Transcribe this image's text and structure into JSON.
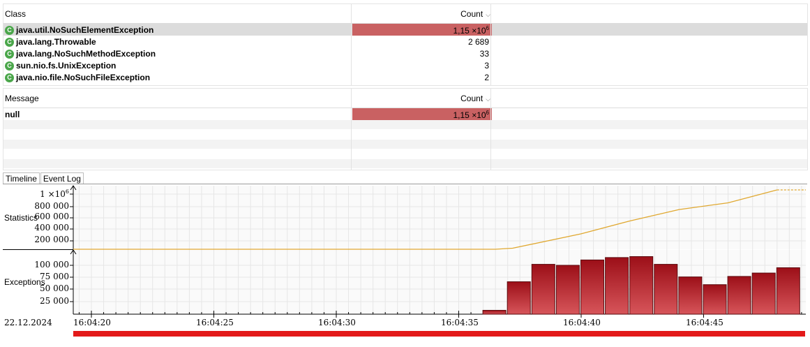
{
  "class_table": {
    "col_class": "Class",
    "col_count": "Count",
    "rows": [
      {
        "name": "java.util.NoSuchElementException",
        "count": "1,15 ×10",
        "exp": "6",
        "fraction": 1.0
      },
      {
        "name": "java.lang.Throwable",
        "count": "2 689",
        "exp": "",
        "fraction": 0
      },
      {
        "name": "java.lang.NoSuchMethodException",
        "count": "33",
        "exp": "",
        "fraction": 0
      },
      {
        "name": "sun.nio.fs.UnixException",
        "count": "3",
        "exp": "",
        "fraction": 0
      },
      {
        "name": "java.nio.file.NoSuchFileException",
        "count": "2",
        "exp": "",
        "fraction": 0
      }
    ]
  },
  "message_table": {
    "col_message": "Message",
    "col_count": "Count",
    "rows": [
      {
        "name": "null",
        "count": "1,15 ×10",
        "exp": "6",
        "fraction": 1.0
      }
    ]
  },
  "tabs": [
    {
      "label": "Timeline",
      "active": true
    },
    {
      "label": "Event Log",
      "active": false
    }
  ],
  "timeline": {
    "date": "22.12.2024",
    "statistics_label": "Statistics",
    "exceptions_label": "Exceptions",
    "stat_ticks": [
      "1 ×10",
      "800 000",
      "600 000",
      "400 000",
      "200 000"
    ],
    "stat_top_exp": "6",
    "exc_ticks": [
      "100 000",
      "75 000",
      "50 000",
      "25 000"
    ],
    "x_ticks": [
      "16:04:20",
      "16:04:25",
      "16:04:30",
      "16:04:35",
      "16:04:40",
      "16:04:45"
    ],
    "line_color": "#e0a830",
    "bar_color": "#b01a22"
  },
  "chart_data": [
    {
      "type": "line",
      "ylabel": "Statistics",
      "ylim": [
        0,
        1150000
      ],
      "series": [
        {
          "x": [
            "16:04:19",
            "16:04:36.5",
            "16:04:37.2",
            "16:04:40",
            "16:04:42",
            "16:04:44",
            "16:04:46",
            "16:04:48"
          ],
          "values": [
            0,
            0,
            20000,
            300000,
            550000,
            770000,
            900000,
            1150000
          ]
        }
      ]
    },
    {
      "type": "bar",
      "ylabel": "Exceptions",
      "ylim": [
        0,
        120000
      ],
      "categories": [
        "16:04:36",
        "16:04:37",
        "16:04:38",
        "16:04:39",
        "16:04:40",
        "16:04:41",
        "16:04:42",
        "16:04:43",
        "16:04:44",
        "16:04:45",
        "16:04:46",
        "16:04:47",
        "16:04:48"
      ],
      "values": [
        8000,
        67000,
        103000,
        101000,
        112000,
        117000,
        119000,
        103000,
        77000,
        61000,
        78000,
        85000,
        96000
      ]
    }
  ]
}
